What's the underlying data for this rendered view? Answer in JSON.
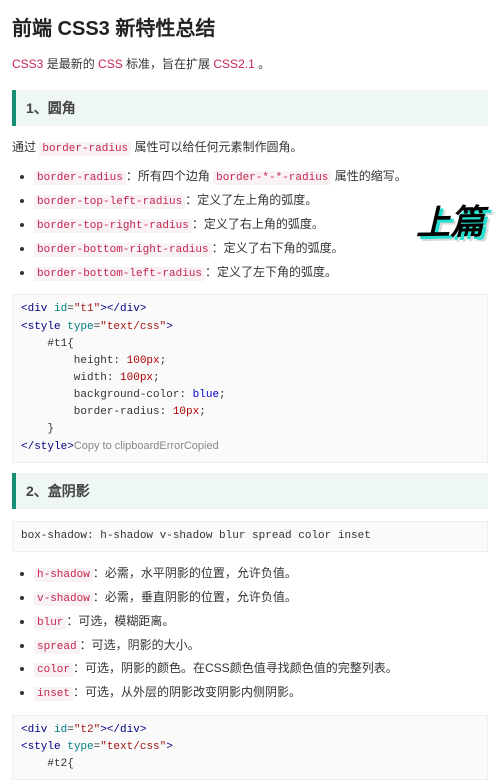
{
  "title": "前端 CSS3 新特性总结",
  "intro": {
    "a": "CSS3",
    "b": " 是最新的 ",
    "c": "CSS",
    "d": " 标准，旨在扩展 ",
    "e": "CSS2.1",
    "f": " 。"
  },
  "stamp": "上篇",
  "s1": {
    "header": "1、圆角",
    "desc_a": "通过 ",
    "desc_code": "border-radius",
    "desc_b": " 属性可以给任何元素制作圆角。",
    "items": [
      {
        "code": "border-radius",
        "t1": "：所有四个边角 ",
        "mid": "border-*-*-radius",
        "t2": " 属性的缩写。"
      },
      {
        "code": "border-top-left-radius",
        "t1": "：定义了左上角的弧度。",
        "mid": "",
        "t2": ""
      },
      {
        "code": "border-top-right-radius",
        "t1": "：定义了右上角的弧度。",
        "mid": "",
        "t2": ""
      },
      {
        "code": "border-bottom-right-radius",
        "t1": "：定义了右下角的弧度。",
        "mid": "",
        "t2": ""
      },
      {
        "code": "border-bottom-left-radius",
        "t1": "：定义了左下角的弧度。",
        "mid": "",
        "t2": ""
      }
    ],
    "code": {
      "l1a": "<div ",
      "l1b": "id",
      "l1c": "=",
      "l1d": "\"t1\"",
      "l1e": "></div>",
      "l2a": "<style ",
      "l2b": "type",
      "l2c": "=",
      "l2d": "\"text/css\"",
      "l2e": ">",
      "l3": "    #t1{",
      "l4a": "        height: ",
      "l4b": "100px",
      "l4c": ";",
      "l5a": "        width: ",
      "l5b": "100px",
      "l5c": ";",
      "l6a": "        background-color: ",
      "l6b": "blue",
      "l6c": ";",
      "l7a": "        border-radius: ",
      "l7b": "10px",
      "l7c": ";",
      "l8": "    }",
      "l9": "</style>",
      "suffix": "Copy to clipboardErrorCopied"
    }
  },
  "s2": {
    "header": "2、盒阴影",
    "headcode": "box-shadow: h-shadow v-shadow blur spread color inset",
    "items": [
      {
        "code": "h-shadow",
        "t": "：必需，水平阴影的位置，允许负值。"
      },
      {
        "code": "v-shadow",
        "t": "：必需，垂直阴影的位置，允许负值。"
      },
      {
        "code": "blur",
        "t": "：可选，模糊距离。"
      },
      {
        "code": "spread",
        "t": "：可选，阴影的大小。"
      },
      {
        "code": "color",
        "t": "：可选，阴影的颜色。在CSS颜色值寻找颜色值的完整列表。"
      },
      {
        "code": "inset",
        "t": "：可选，从外层的阴影改变阴影内侧阴影。"
      }
    ],
    "code": {
      "l1a": "<div ",
      "l1b": "id",
      "l1c": "=",
      "l1d": "\"t2\"",
      "l1e": "></div>",
      "l2a": "<style ",
      "l2b": "type",
      "l2c": "=",
      "l2d": "\"text/css\"",
      "l2e": ">",
      "l3": "    #t2{"
    }
  }
}
